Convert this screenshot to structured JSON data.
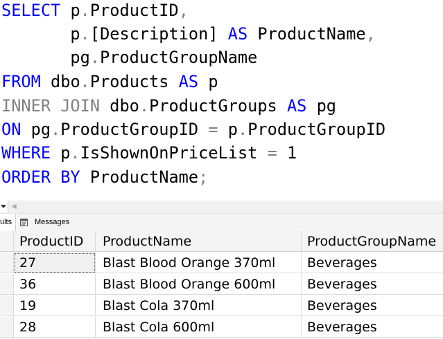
{
  "editor": {
    "lines": [
      [
        {
          "t": "SELECT",
          "c": "kw"
        },
        {
          "t": " p",
          "c": "id"
        },
        {
          "t": ".",
          "c": "op"
        },
        {
          "t": "ProductID",
          "c": "id"
        },
        {
          "t": ",",
          "c": "op"
        }
      ],
      [
        {
          "t": "       p",
          "c": "id"
        },
        {
          "t": ".",
          "c": "op"
        },
        {
          "t": "[Description]",
          "c": "id"
        },
        {
          "t": " AS",
          "c": "kw"
        },
        {
          "t": " ProductName",
          "c": "id"
        },
        {
          "t": ",",
          "c": "op"
        }
      ],
      [
        {
          "t": "       pg",
          "c": "id"
        },
        {
          "t": ".",
          "c": "op"
        },
        {
          "t": "ProductGroupName",
          "c": "id"
        }
      ],
      [
        {
          "t": "FROM",
          "c": "kw"
        },
        {
          "t": " dbo",
          "c": "id"
        },
        {
          "t": ".",
          "c": "op"
        },
        {
          "t": "Products",
          "c": "id"
        },
        {
          "t": " AS",
          "c": "kw"
        },
        {
          "t": " p",
          "c": "id"
        }
      ],
      [
        {
          "t": "INNER JOIN",
          "c": "op"
        },
        {
          "t": " dbo",
          "c": "id"
        },
        {
          "t": ".",
          "c": "op"
        },
        {
          "t": "ProductGroups",
          "c": "id"
        },
        {
          "t": " AS",
          "c": "kw"
        },
        {
          "t": " pg",
          "c": "id"
        }
      ],
      [
        {
          "t": "ON",
          "c": "kw"
        },
        {
          "t": " pg",
          "c": "id"
        },
        {
          "t": ".",
          "c": "op"
        },
        {
          "t": "ProductGroupID",
          "c": "id"
        },
        {
          "t": " = ",
          "c": "op"
        },
        {
          "t": "p",
          "c": "id"
        },
        {
          "t": ".",
          "c": "op"
        },
        {
          "t": "ProductGroupID",
          "c": "id"
        }
      ],
      [
        {
          "t": "WHERE",
          "c": "kw"
        },
        {
          "t": " p",
          "c": "id"
        },
        {
          "t": ".",
          "c": "op"
        },
        {
          "t": "IsShownOnPriceList",
          "c": "id"
        },
        {
          "t": " = ",
          "c": "op"
        },
        {
          "t": "1",
          "c": "num"
        }
      ],
      [
        {
          "t": "ORDER BY",
          "c": "kw"
        },
        {
          "t": " ProductName",
          "c": "id"
        },
        {
          "t": ";",
          "c": "op"
        }
      ]
    ]
  },
  "tabs": {
    "results_label": "ults",
    "messages_label": "Messages"
  },
  "grid": {
    "columns": [
      "ProductID",
      "ProductName",
      "ProductGroupName"
    ],
    "rows": [
      [
        "27",
        "Blast Blood Orange 370ml",
        "Beverages"
      ],
      [
        "36",
        "Blast Blood Orange 600ml",
        "Beverages"
      ],
      [
        "19",
        "Blast Cola 370ml",
        "Beverages"
      ],
      [
        "28",
        "Blast Cola 600ml",
        "Beverages"
      ]
    ]
  },
  "colors": {
    "keyword": "#0000ff",
    "operator": "#808080",
    "identifier": "#000000"
  }
}
